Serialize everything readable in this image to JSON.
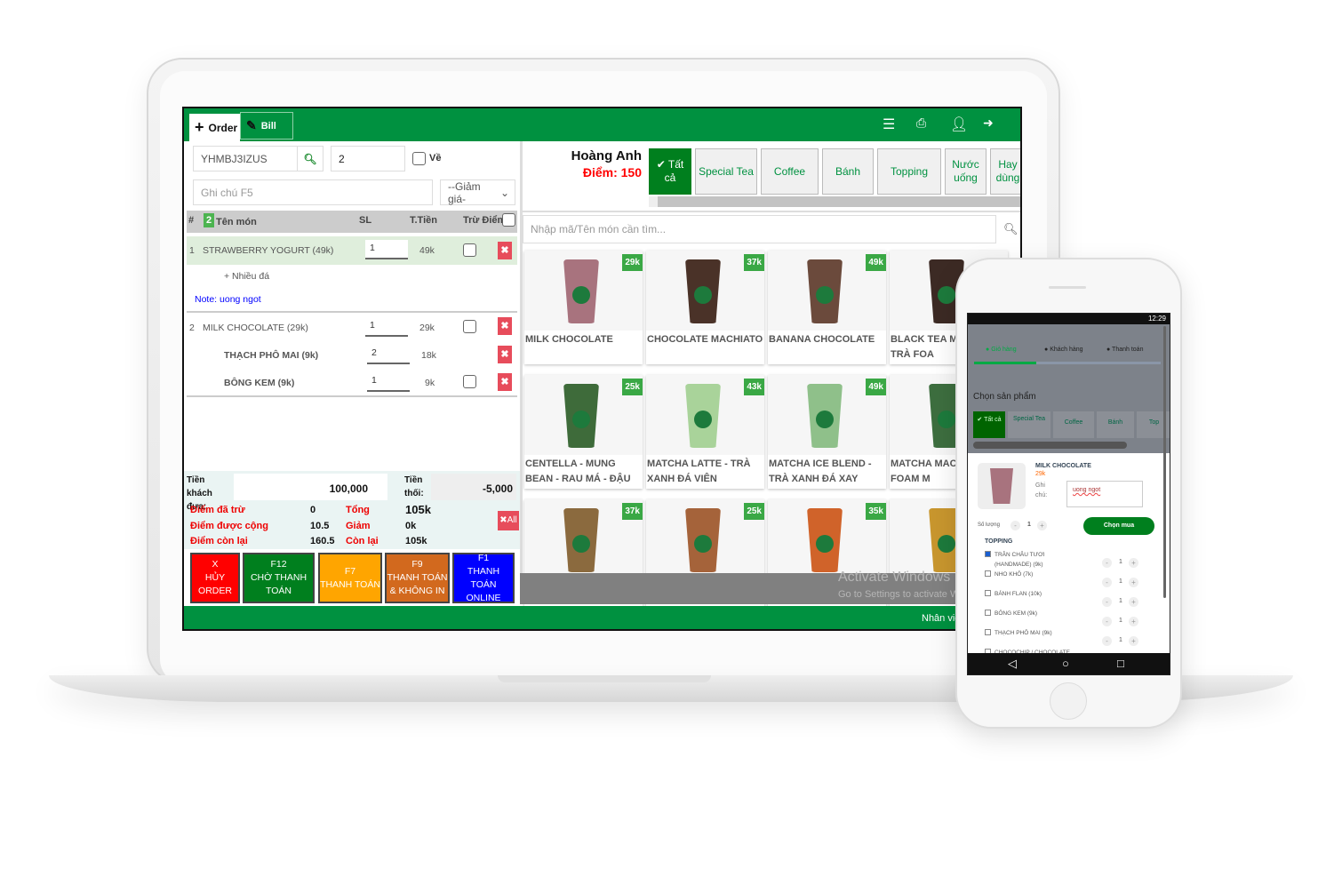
{
  "topbar": {
    "order_tab": "Order",
    "bill_tab": "Bill",
    "icons": [
      "menu-icon",
      "print-icon",
      "user-icon",
      "logout-icon"
    ]
  },
  "order": {
    "code": "YHMBJ3IZUS",
    "table": "2",
    "takeaway_label": "Về",
    "note_placeholder": "Ghi chú F5",
    "discount_select": "--Giảm giá-",
    "headers": {
      "hash": "#",
      "count": "2",
      "name": "Tên món",
      "qty": "SL",
      "total": "T.Tiền",
      "points": "Trừ Điểm"
    },
    "items": [
      {
        "no": "1",
        "name": "STRAWBERRY YOGURT (49k)",
        "qty": "1",
        "total": "49k",
        "extra": "+ Nhiều đá",
        "note": "Note: uong ngot"
      },
      {
        "no": "2",
        "name": "MILK CHOCOLATE (29k)",
        "qty": "1",
        "total": "29k"
      }
    ],
    "toppings": [
      {
        "name": "THẠCH PHÔ MAI (9k)",
        "qty": "2",
        "total": "18k"
      },
      {
        "name": "BÔNG KEM (9k)",
        "qty": "1",
        "total": "9k"
      }
    ]
  },
  "summary": {
    "cash_label": "Tiền khách đưa:",
    "cash": "100,000",
    "change_label": "Tiền thối:",
    "change": "-5,000",
    "points_used_label": "Điểm đã trừ",
    "points_used": "0",
    "points_added_label": "Điểm được cộng",
    "points_added": "10.5",
    "points_left_label": "Điểm còn lại",
    "points_left": "160.5",
    "total_label": "Tổng",
    "total": "105k",
    "discount_label": "Giảm",
    "discount": "0k",
    "remaining_label": "Còn lại",
    "remaining": "105k",
    "clear_all": "✖All"
  },
  "actions": [
    {
      "l1": "X",
      "l2": "HỦY",
      "l3": "ORDER",
      "color": "#ff0000"
    },
    {
      "l1": "F12",
      "l2": "CHỜ THANH",
      "l3": "TOÁN",
      "color": "#007f1e"
    },
    {
      "l1": "F7",
      "l2": "THANH TOÁN",
      "l3": "",
      "color": "#ffa500"
    },
    {
      "l1": "F9",
      "l2": "THANH TOÁN",
      "l3": "& KHÔNG IN",
      "color": "#d2691e"
    },
    {
      "l1": "F1",
      "l2": "THANH TOÁN",
      "l3": "ONLINE",
      "color": "#0000ff"
    }
  ],
  "customer": {
    "name": "Hoàng Anh",
    "points": "Điểm: 150"
  },
  "categories": [
    {
      "label": "✔ Tất cả",
      "active": true
    },
    {
      "label": "Special Tea"
    },
    {
      "label": "Coffee"
    },
    {
      "label": "Bánh"
    },
    {
      "label": "Topping"
    },
    {
      "label": "Nước uống"
    },
    {
      "label": "Hay dùng"
    }
  ],
  "search_placeholder": "Nhập mã/Tên món cần tìm...",
  "products": [
    {
      "name": "MILK CHOCOLATE",
      "price": "29k",
      "color": "#a8737e"
    },
    {
      "name": "CHOCOLATE MACHIATO",
      "price": "37k",
      "color": "#4a3228"
    },
    {
      "name": "BANANA CHOCOLATE",
      "price": "49k",
      "color": "#6b4a3c"
    },
    {
      "name": "BLACK TEA MA HỒNG TRÀ FOA",
      "price": "",
      "color": "#3c2a24"
    },
    {
      "name": "CENTELLA - MUNG BEAN - RAU MÁ - ĐẬU XANH",
      "price": "25k",
      "color": "#3e6b3a"
    },
    {
      "name": "MATCHA LATTE - TRÀ XANH ĐÁ VIÊN",
      "price": "43k",
      "color": "#a9d39a"
    },
    {
      "name": "MATCHA ICE BLEND - TRÀ XANH ĐÁ XAY",
      "price": "49k",
      "color": "#8fc08a"
    },
    {
      "name": "MATCHA MACH XANH FOAM M",
      "price": "",
      "color": "#3d6e3f"
    },
    {
      "name": "",
      "price": "37k",
      "color": "#8b6a3e"
    },
    {
      "name": "",
      "price": "25k",
      "color": "#a5633a"
    },
    {
      "name": "",
      "price": "35k",
      "color": "#d0632a"
    },
    {
      "name": "",
      "price": "",
      "color": "#c8962e"
    }
  ],
  "watermark": {
    "title": "Activate Windows",
    "sub": "Go to Settings to activate W"
  },
  "footer_text": "Nhân viê",
  "phone": {
    "time": "12:29",
    "steps": [
      "Giỏ hàng",
      "Khách hàng",
      "Thanh toán"
    ],
    "title": "Chọn sản phẩm",
    "categories": [
      "✔ Tất cả",
      "Special Tea",
      "Coffee",
      "Bánh",
      "Top"
    ],
    "product": {
      "name": "MILK CHOCOLATE",
      "price": "29k",
      "note_label": "Ghi chú:",
      "note": "uong ngot",
      "qty_label": "Số lượng",
      "qty": "1",
      "buy": "Chọn mua"
    },
    "topping_title": "TOPPING",
    "toppings": [
      {
        "name": "TRÂN CHÂU TƯƠI (HANDMADE) (9k)",
        "checked": true,
        "qty": "1"
      },
      {
        "name": "NHO KHÔ (7k)",
        "qty": "1"
      },
      {
        "name": "BÁNH FLAN (10k)",
        "qty": "1"
      },
      {
        "name": "BÔNG KEM (9k)",
        "qty": "1"
      },
      {
        "name": "THẠCH PHÔ MAI (9k)",
        "qty": "1"
      },
      {
        "name": "CHOCOCHIP / CHOCOLATE"
      }
    ]
  },
  "colors": {
    "brand_green": "#009140",
    "price_green": "#3aa845",
    "delete_red": "#e74c5b"
  }
}
